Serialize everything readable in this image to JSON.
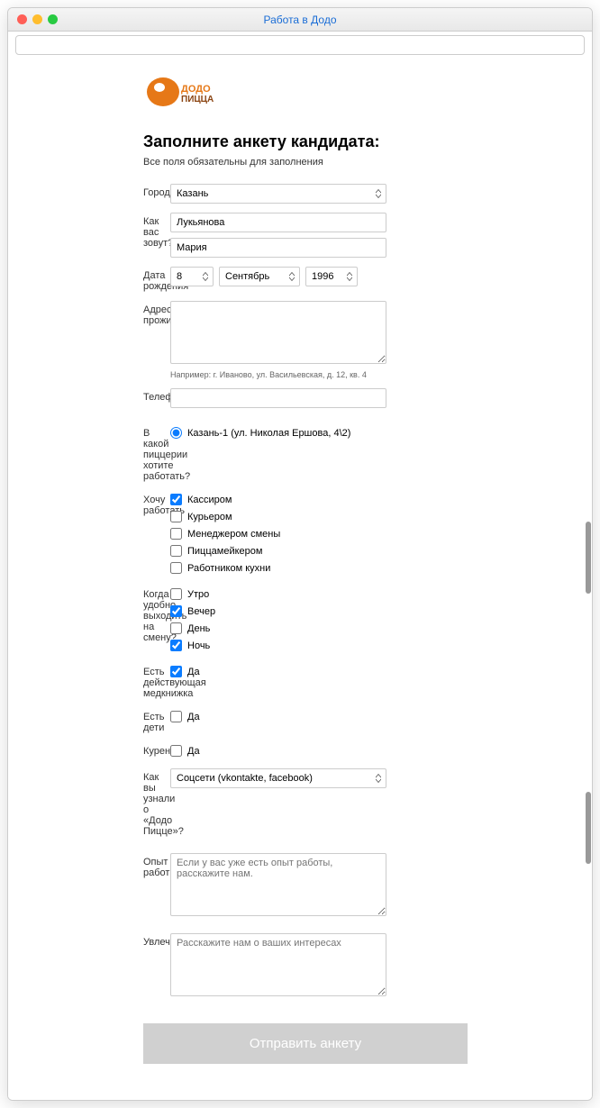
{
  "window": {
    "title": "Работа в Додо"
  },
  "page": {
    "heading": "Заполните анкету кандидата:",
    "subtitle": "Все поля обязательны для заполнения"
  },
  "form": {
    "city": {
      "label": "Город",
      "value": "Казань"
    },
    "name": {
      "label": "Как вас зовут?",
      "last": "Лукьянова",
      "first": "Мария"
    },
    "dob": {
      "label": "Дата рождения",
      "day": "8",
      "month": "Сентябрь",
      "year": "1996"
    },
    "address": {
      "label": "Адрес проживания",
      "hint": "Например: г. Иваново, ул. Васильевская, д. 12, кв. 4"
    },
    "phone": {
      "label": "Телефон"
    },
    "pizzeria": {
      "label": "В какой пиццерии хотите работать?",
      "opt1": "Казань-1 (ул. Николая Ершова, 4\\2)"
    },
    "role": {
      "label": "Хочу работать",
      "o1": "Кассиром",
      "o2": "Курьером",
      "o3": "Менеджером смены",
      "o4": "Пиццамейкером",
      "o5": "Работником кухни"
    },
    "shift": {
      "label": "Когда удобно выходить на смену?",
      "o1": "Утро",
      "o2": "Вечер",
      "o3": "День",
      "o4": "Ночь"
    },
    "medbook": {
      "label": "Есть действующая медкнижка",
      "opt": "Да"
    },
    "kids": {
      "label": "Есть дети",
      "opt": "Да"
    },
    "smoke": {
      "label": "Курение",
      "opt": "Да"
    },
    "source": {
      "label": "Как вы узнали о «Додо Пицце»?",
      "value": "Соцсети (vkontakte, facebook)"
    },
    "exp": {
      "label": "Опыт работы",
      "placeholder": "Если у вас уже есть опыт работы, расскажите нам."
    },
    "hobby": {
      "label": "Увлечения",
      "placeholder": "Расскажите нам о ваших интересах"
    },
    "submit": "Отправить анкету"
  }
}
